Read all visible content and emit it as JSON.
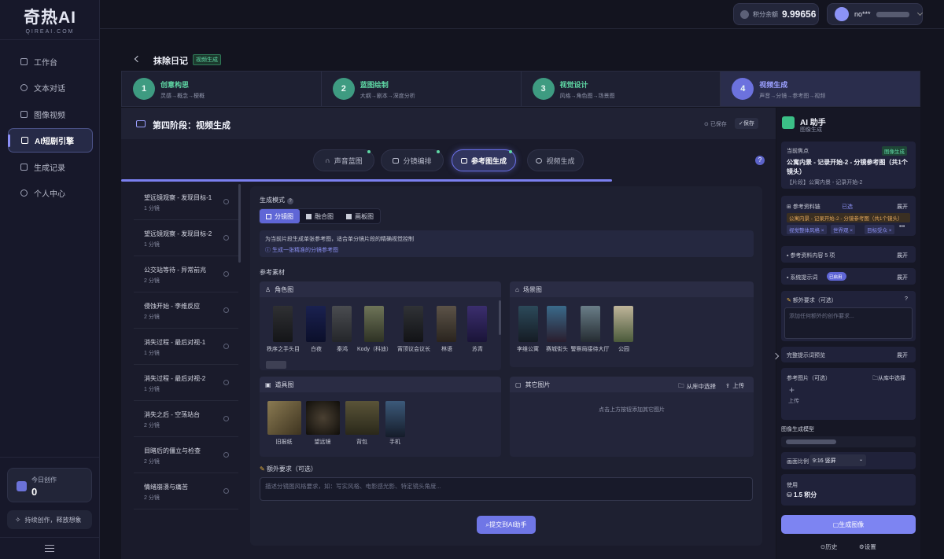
{
  "brand": {
    "title": "奇热AI",
    "subtitle": "QIREAI.COM"
  },
  "nav": [
    {
      "label": "工作台",
      "icon": "home-icon"
    },
    {
      "label": "文本对话",
      "icon": "chat-icon"
    },
    {
      "label": "图像视频",
      "icon": "image-icon"
    },
    {
      "label": "AI短剧引擎",
      "icon": "film-icon",
      "active": true
    },
    {
      "label": "生成记录",
      "icon": "history-icon"
    },
    {
      "label": "个人中心",
      "icon": "user-icon"
    }
  ],
  "stats": {
    "label": "今日创作",
    "value": "0"
  },
  "promo": "持续创作，释放想象",
  "topbar": {
    "balance_label": "积分余额",
    "balance_value": "9.99656",
    "user_name": "no***"
  },
  "page": {
    "title": "抹除日记",
    "tag": "视频生成"
  },
  "steps": [
    {
      "num": "1",
      "title": "创意构思",
      "desc": "灵感→概念→梗概"
    },
    {
      "num": "2",
      "title": "蓝图绘制",
      "desc": "大纲→剧本→深度分析"
    },
    {
      "num": "3",
      "title": "视觉设计",
      "desc": "风格→角色图→场景图"
    },
    {
      "num": "4",
      "title": "视频生成",
      "desc": "声音→分镜→参考图→视频"
    }
  ],
  "stage": {
    "title": "第四阶段：视频生成",
    "saved": "已保存",
    "save_btn": "保存"
  },
  "subtabs": [
    "声音蓝图",
    "分镜编排",
    "参考图生成",
    "视频生成"
  ],
  "segments": [
    {
      "title": "望远镜观察 - 发现目标-1",
      "count": "1 分镜"
    },
    {
      "title": "望远镜观察 - 发现目标-2",
      "count": "1 分镜"
    },
    {
      "title": "公交站等待 - 异常前兆",
      "count": "2 分镜"
    },
    {
      "title": "侵蚀开始 - 李维反应",
      "count": "2 分镜"
    },
    {
      "title": "消失过程 - 最后对视-1",
      "count": "1 分镜"
    },
    {
      "title": "消失过程 - 最后对视-2",
      "count": "1 分镜"
    },
    {
      "title": "消失之后 - 空荡站台",
      "count": "2 分镜"
    },
    {
      "title": "目睹后的僵立与检查",
      "count": "2 分镜"
    },
    {
      "title": "情绪崩溃与痛苦",
      "count": "2 分镜"
    }
  ],
  "mode": {
    "label": "生成模式",
    "options": [
      "分镜图",
      "融合图",
      "画板图"
    ],
    "info": "为当前片段生成单张参考图，适合单分镜片段的精确视觉控制",
    "link": "生成一张精准的分镜参考图"
  },
  "refs": {
    "label": "参考素材",
    "characters": {
      "title": "角色图",
      "items": [
        "秩序之手头目",
        "白夜",
        "秦鸿",
        "Kody（科迪）",
        "宵顶议会议长",
        "林语",
        "苏青"
      ]
    },
    "scenes": {
      "title": "场景图",
      "items": [
        "李维公寓",
        "赛城街头",
        "警察局接待大厅",
        "公园"
      ]
    },
    "props": {
      "title": "道具图",
      "items": [
        "旧报纸",
        "望远镜",
        "背包",
        "手机"
      ]
    },
    "others": {
      "title": "其它图片",
      "lib_btn": "从库中选择",
      "upload_btn": "上传",
      "empty": "点击上方按钮添加其它图片"
    }
  },
  "extra": {
    "label": "额外要求（可选）",
    "placeholder": "描述分镜图风格要求，如：写实风格、电影感光影、特定镜头角度..."
  },
  "submit": "提交到AI助手",
  "assistant": {
    "title": "AI 助手",
    "subtitle": "图像生成",
    "focus_label": "当前焦点",
    "focus_tag": "图像生成",
    "focus_title": "公寓内景 - 记录开始-2 - 分镜参考图（共1个镜头）",
    "focus_sub": "【片段】公寓内景 - 记录开始-2",
    "ref_label": "参考资料链",
    "ref_state": "已选",
    "expand": "展开",
    "ref_chip": "公寓内景 - 记录开始-2 - 分镜参考图（共1个镜头）",
    "chips": [
      "视觉整体风格",
      "世界观",
      "目标受众"
    ],
    "ref_content": "参考资料内容 5 项",
    "sys_prompt": "系统提示词",
    "toggle": "已启用",
    "extra_label": "额外要求（可选）",
    "extra_placeholder": "添加任何额外的创作要求...",
    "preview": "完整提示词预览",
    "ref_img": "参考图片（可选）",
    "ref_img_btn": "从库中选择",
    "upload": "上传",
    "model_label": "图像生成模型",
    "ratio_label": "画面比例",
    "ratio_value": "9:16 竖屏",
    "use_label": "使用",
    "use_value": "1.5 积分",
    "gen_btn": "生成图像",
    "history": "历史",
    "settings": "设置"
  },
  "colors": {
    "accent": "#6c72de",
    "green": "#3e9b81",
    "bg": "#13141f"
  }
}
